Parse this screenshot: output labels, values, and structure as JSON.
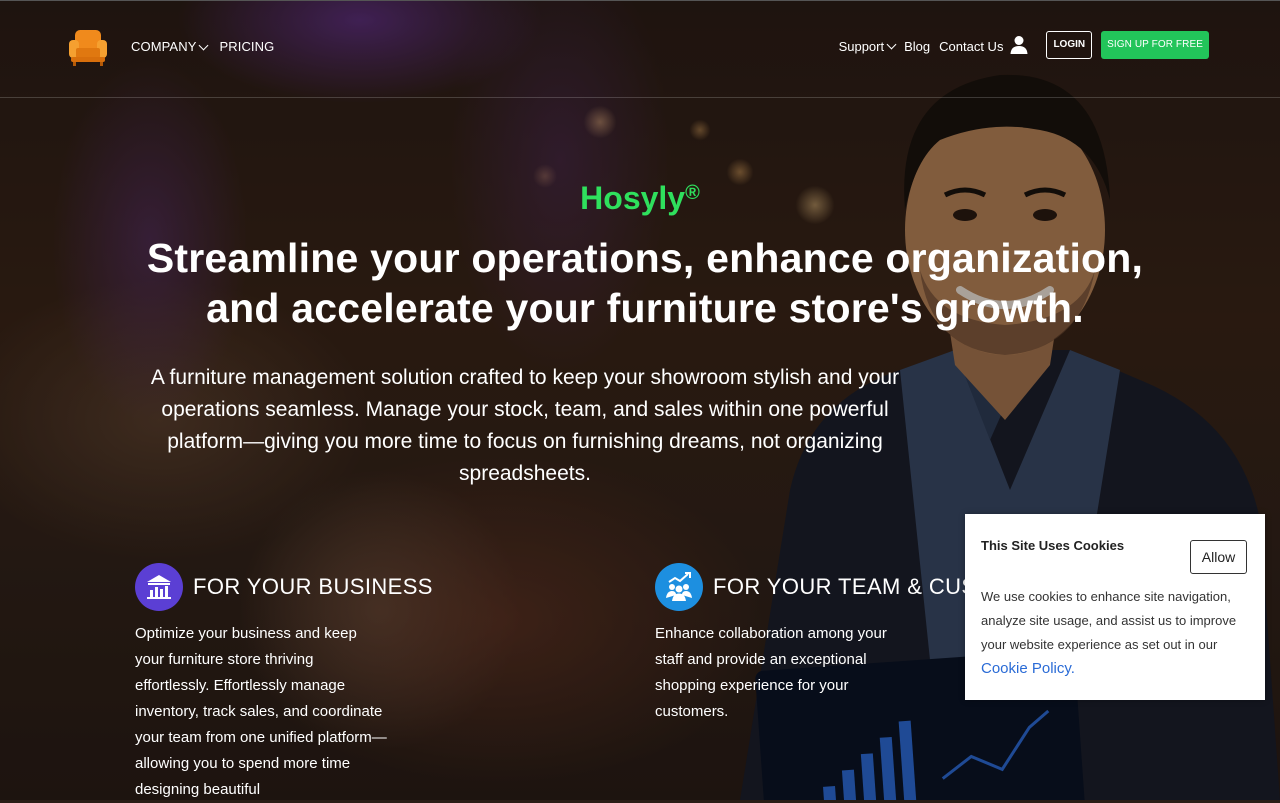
{
  "header": {
    "logo_icon": "armchair-icon",
    "nav_left": [
      {
        "label": "COMPANY",
        "dropdown": true
      },
      {
        "label": "PRICING",
        "dropdown": false
      }
    ],
    "nav_right": [
      {
        "label": "Support",
        "dropdown": true
      },
      {
        "label": "Blog",
        "dropdown": false
      },
      {
        "label": "Contact Us",
        "dropdown": false
      }
    ],
    "user_icon": "user-icon",
    "login_label": "LOGIN",
    "signup_label": "SIGN UP FOR FREE"
  },
  "hero": {
    "brand": "Hosyly",
    "brand_mark": "®",
    "headline_line1": "Streamline your operations, enhance organization,",
    "headline_line2": "and accelerate your furniture store's growth.",
    "subhead": "A furniture management solution crafted to keep your showroom stylish and your operations seamless. Manage your stock, team, and sales within one powerful platform—giving you more time to focus on furnishing dreams, not organizing spreadsheets."
  },
  "features": [
    {
      "icon": "business-chart-icon",
      "title": "FOR YOUR BUSINESS",
      "text": "Optimize your business and keep your furniture store thriving effortlessly. Effortlessly manage inventory, track sales, and coordinate your team from one unified platform—allowing you to spend more time designing beautiful"
    },
    {
      "icon": "team-growth-icon",
      "title": "FOR YOUR TEAM & CUSTOMERS",
      "text": "Enhance collaboration among your staff and provide an exceptional shopping experience for your customers."
    }
  ],
  "cookie_banner": {
    "title": "This Site Uses Cookies",
    "allow_label": "Allow",
    "body": "We use cookies to enhance site navigation, analyze site usage, and assist us to improve your website experience as set out in our",
    "link_label": "Cookie Policy."
  },
  "colors": {
    "brand_green": "#2fe05d",
    "signup_green": "#22c45a",
    "business_icon_bg": "#5b3fd4",
    "team_icon_bg": "#1d8fe0",
    "cookie_link": "#2a6bd6"
  }
}
